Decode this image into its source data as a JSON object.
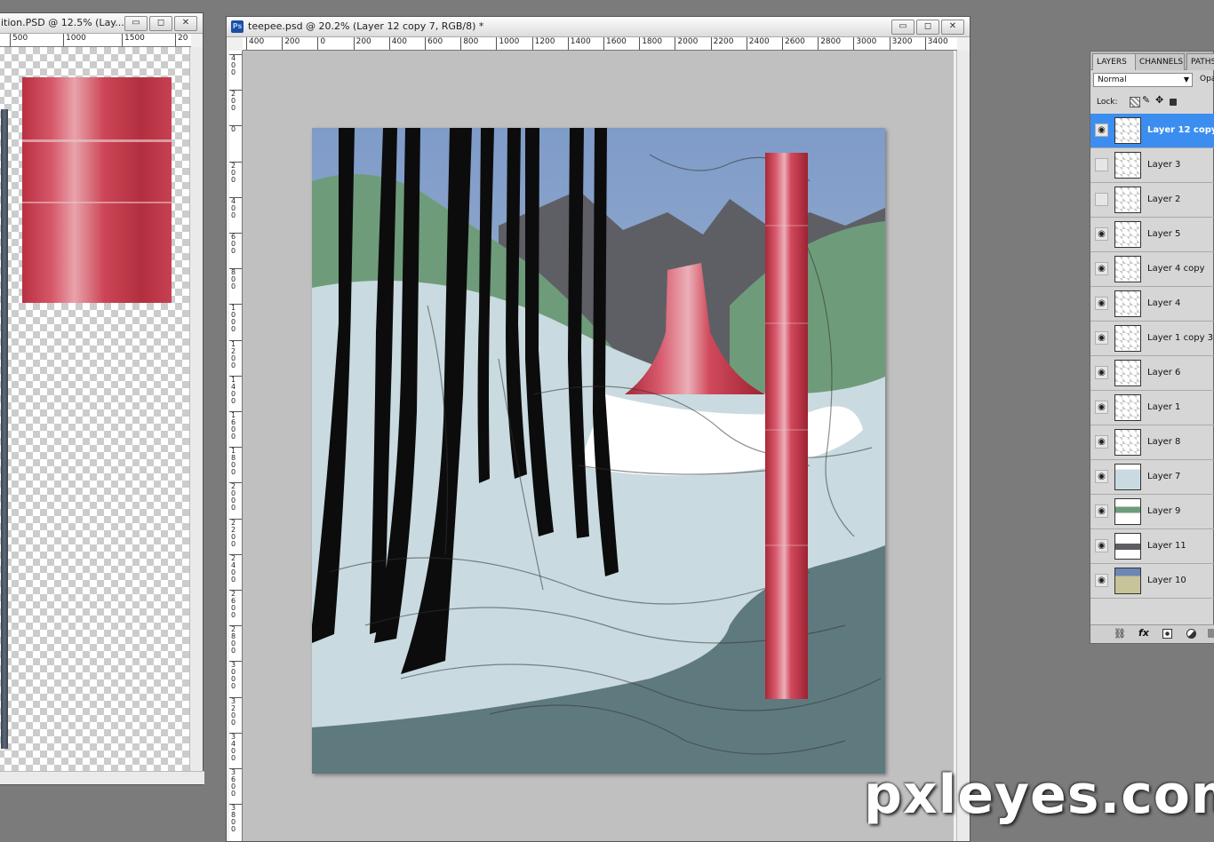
{
  "left_window": {
    "title": "ition.PSD @ 12.5% (Lay...",
    "ruler_labels": [
      "500",
      "1000",
      "1500",
      "20"
    ],
    "min_glyph": "▭",
    "max_glyph": "◻",
    "close_glyph": "✕"
  },
  "main_window": {
    "title": "teepee.psd @ 20.2% (Layer 12 copy 7, RGB/8) *",
    "app_icon": "Ps",
    "min_glyph": "▭",
    "max_glyph": "◻",
    "close_glyph": "✕",
    "h_ruler": [
      "400",
      "200",
      "0",
      "200",
      "400",
      "600",
      "800",
      "1000",
      "1200",
      "1400",
      "1600",
      "1800",
      "2000",
      "2200",
      "2400",
      "2600",
      "2800",
      "3000",
      "3200",
      "3400"
    ],
    "v_ruler": [
      "400",
      "200",
      "0",
      "200",
      "400",
      "600",
      "800",
      "1000",
      "1200",
      "1400",
      "1600",
      "1800",
      "2000",
      "2200",
      "2400",
      "2600",
      "2800",
      "3000",
      "3200",
      "3400",
      "3600",
      "3800"
    ]
  },
  "layers_panel": {
    "tabs": [
      "LAYERS",
      "CHANNELS",
      "PATHS"
    ],
    "blend_mode": "Normal",
    "opacity_label": "Opa",
    "lock_label": "Lock:",
    "layers": [
      {
        "name": "Layer 12 copy",
        "visible": true,
        "selected": true
      },
      {
        "name": "Layer 3",
        "visible": false
      },
      {
        "name": "Layer 2",
        "visible": false
      },
      {
        "name": "Layer 5",
        "visible": true
      },
      {
        "name": "Layer 4 copy",
        "visible": true
      },
      {
        "name": "Layer 4",
        "visible": true
      },
      {
        "name": "Layer 1 copy 3",
        "visible": true
      },
      {
        "name": "Layer 6",
        "visible": true
      },
      {
        "name": "Layer 1",
        "visible": true
      },
      {
        "name": "Layer 8",
        "visible": true
      },
      {
        "name": "Layer 7",
        "visible": true
      },
      {
        "name": "Layer 9",
        "visible": true
      },
      {
        "name": "Layer 11",
        "visible": true
      },
      {
        "name": "Layer 10",
        "visible": true
      }
    ],
    "footer_icons": [
      "link-icon",
      "fx-icon",
      "mask-icon",
      "adjustment-icon",
      "group-icon"
    ]
  },
  "watermark": "pxleyes.com",
  "colors": {
    "selection": "#3b8ef0",
    "pillar_red": "#c8404e",
    "snow": "#c9dbe0",
    "river": "#5f7a7e",
    "hills": "#6e9c7a",
    "mountains": "#5e5f65",
    "sky": "#8aa4c8"
  }
}
